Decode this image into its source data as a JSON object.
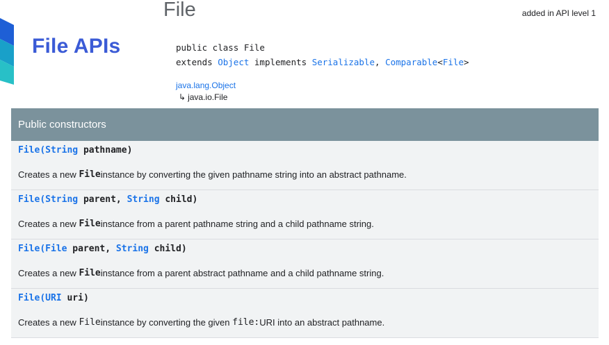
{
  "banner": {
    "title": "File APIs",
    "colors": [
      "#1e5fd6",
      "#19a0c9",
      "#28c0c7"
    ]
  },
  "header": {
    "title": "File",
    "api_level": "added in API level 1",
    "signature": {
      "line1": "public class File",
      "extends_kw": "extends",
      "superclass": "Object",
      "implements_kw": "implements",
      "iface1": "Serializable",
      "comma": ",",
      "iface2": "Comparable",
      "generic_open": "<",
      "generic_type": "File",
      "generic_close": ">"
    },
    "hierarchy": {
      "parent": "java.lang.Object",
      "arrow": "↳",
      "child": "java.io.File"
    }
  },
  "constructors": {
    "heading": "Public constructors",
    "rows": [
      {
        "name": "File",
        "params": [
          {
            "type": "String",
            "name": "pathname"
          }
        ],
        "desc_before": "Creates a new ",
        "desc_code": "File",
        "desc_after": " instance by converting the given pathname string into an abstract pathname."
      },
      {
        "name": "File",
        "params": [
          {
            "type": "String",
            "name": "parent"
          },
          {
            "type": "String",
            "name": "child"
          }
        ],
        "desc_before": "Creates a new ",
        "desc_code": "File",
        "desc_after": " instance from a parent pathname string and a child pathname string."
      },
      {
        "name": "File",
        "params": [
          {
            "type": "File",
            "name": "parent"
          },
          {
            "type": "String",
            "name": "child"
          }
        ],
        "desc_before": "Creates a new ",
        "desc_code": "File",
        "desc_after": " instance from a parent abstract pathname and a child pathname string."
      },
      {
        "name": "File",
        "params": [
          {
            "type": "URI",
            "name": "uri"
          }
        ],
        "desc_before": "Creates a new ",
        "desc_code": "File",
        "desc_mid": " instance by converting the given ",
        "desc_code2": "file:",
        "desc_after": " URI into an abstract pathname."
      }
    ]
  }
}
